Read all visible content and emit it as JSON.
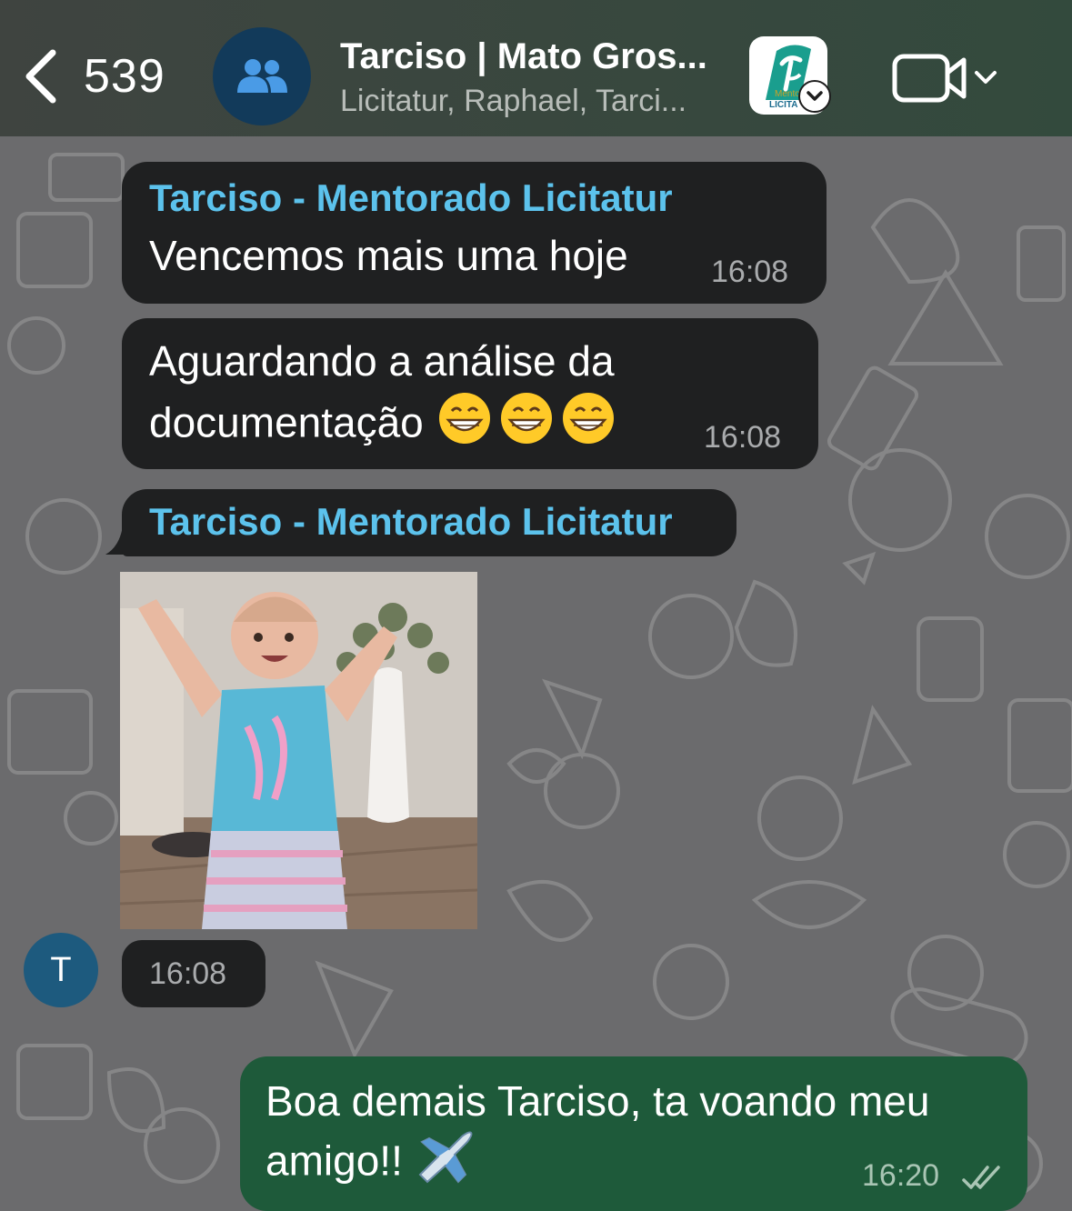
{
  "header": {
    "back_count": "539",
    "title": "Tarciso | Mato Gros...",
    "subtitle": "Licitatur, Raphael, Tarci...",
    "app_shortcut_label": "Mento LICITA"
  },
  "messages": [
    {
      "sender": "Tarciso - Mentorado Licitatur",
      "text": "Vencemos mais uma hoje",
      "time": "16:08"
    },
    {
      "text_line1": "Aguardando a análise da",
      "text_line2": "documentação",
      "emoji": "😁😁😁",
      "time": "16:08"
    },
    {
      "sender": "Tarciso - Mentorado Licitatur",
      "media": "gif",
      "time": "16:08",
      "avatar_initial": "T"
    },
    {
      "outgoing": true,
      "text_line1": "Boa demais Tarciso, ta voando meu",
      "text_line2": "amigo!!",
      "emoji": "✈️",
      "time": "16:20",
      "status": "read"
    }
  ],
  "colors": {
    "header_bg": "#334a3d",
    "incoming_bubble": "#1f2021",
    "outgoing_bubble": "#1e5a3a",
    "sender_name": "#5cc2ec",
    "wallpaper": "#6b6b6d"
  }
}
